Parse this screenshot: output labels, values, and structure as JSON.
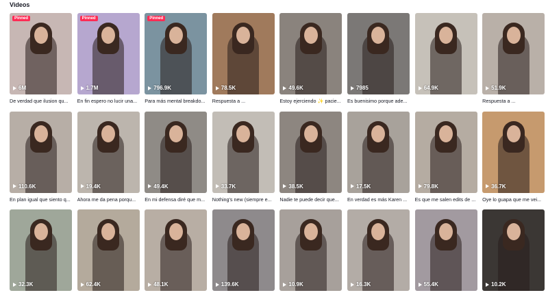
{
  "section_title": "Videos",
  "badge_label": "Pinned",
  "videos": [
    {
      "views": "6M",
      "caption": "De verdad que ilusion qu...",
      "pinned": true,
      "bg": "#c7b7b4"
    },
    {
      "views": "1.7M",
      "caption": "En fin espero no lucir una...",
      "pinned": true,
      "bg": "#b6a7cf"
    },
    {
      "views": "796.9K",
      "caption": "Para más mental breakdo...",
      "pinned": true,
      "bg": "#7b93a0"
    },
    {
      "views": "78.5K",
      "caption": "Respuesta a ...",
      "pinned": false,
      "bg": "#a07a5c"
    },
    {
      "views": "49.6K",
      "caption": "Estoy ejerciendo ✨ pacie...",
      "pinned": false,
      "bg": "#8a837d"
    },
    {
      "views": "7985",
      "caption": "Es buenisimo porque ade...",
      "pinned": false,
      "bg": "#7b7876"
    },
    {
      "views": "64.9K",
      "caption": "",
      "pinned": false,
      "bg": "#c6c1b9"
    },
    {
      "views": "51.9K",
      "caption": "Respuesta a ...",
      "pinned": false,
      "bg": "#b9b0a8"
    },
    {
      "views": "110.6K",
      "caption": "En plan igual que siento q...",
      "pinned": false,
      "bg": "#b7aea6"
    },
    {
      "views": "19.4K",
      "caption": "Ahora me da pena porqu...",
      "pinned": false,
      "bg": "#bcb5ad"
    },
    {
      "views": "49.4K",
      "caption": "En mi defensa diré que m...",
      "pinned": false,
      "bg": "#8f8b86"
    },
    {
      "views": "33.7K",
      "caption": "Nothing's new (siempre e...",
      "pinned": false,
      "bg": "#c2bdb6"
    },
    {
      "views": "38.5K",
      "caption": "Nadie te puede decir que...",
      "pinned": false,
      "bg": "#8d8680"
    },
    {
      "views": "17.5K",
      "caption": "En verdad es más Karen ...",
      "pinned": false,
      "bg": "#a8a29b"
    },
    {
      "views": "79.8K",
      "caption": "Es que me salen edits de ...",
      "pinned": false,
      "bg": "#b5aca2"
    },
    {
      "views": "36.7K",
      "caption": "Oye lo guapa que me vei...",
      "pinned": false,
      "bg": "#c69a6e"
    },
    {
      "views": "32.3K",
      "caption": "",
      "pinned": false,
      "bg": "#9fa79a"
    },
    {
      "views": "62.4K",
      "caption": "",
      "pinned": false,
      "bg": "#b4aa9c"
    },
    {
      "views": "48.1K",
      "caption": "",
      "pinned": false,
      "bg": "#b8aea4"
    },
    {
      "views": "139.6K",
      "caption": "",
      "pinned": false,
      "bg": "#8e8a8c"
    },
    {
      "views": "10.9K",
      "caption": "",
      "pinned": false,
      "bg": "#a7a09b"
    },
    {
      "views": "16.3K",
      "caption": "",
      "pinned": false,
      "bg": "#b3aca6"
    },
    {
      "views": "55.4K",
      "caption": "",
      "pinned": false,
      "bg": "#a29aa0"
    },
    {
      "views": "10.2K",
      "caption": "",
      "pinned": false,
      "bg": "#3b3734"
    }
  ]
}
